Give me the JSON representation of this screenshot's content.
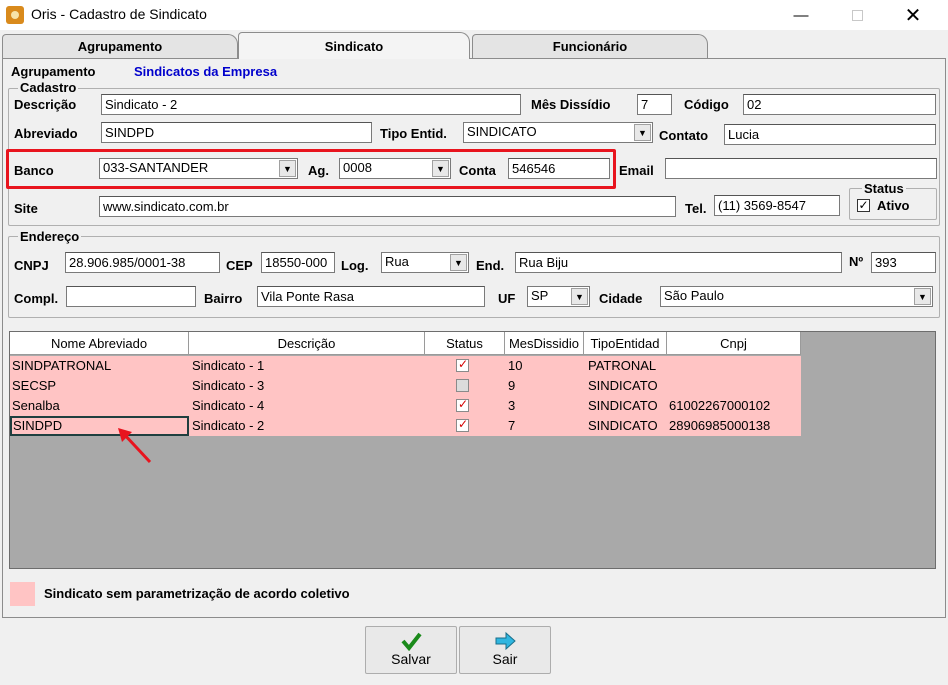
{
  "window": {
    "title": "Oris - Cadastro de Sindicato"
  },
  "tabs": [
    "Agrupamento",
    "Sindicato",
    "Funcionário"
  ],
  "agrupamento": {
    "label": "Agrupamento",
    "value": "Sindicatos da Empresa"
  },
  "cadastro": {
    "title": "Cadastro",
    "descricao_label": "Descrição",
    "descricao": "Sindicato - 2",
    "mes_dissidio_label": "Mês Dissídio",
    "mes_dissidio": "7",
    "codigo_label": "Código",
    "codigo": "02",
    "abreviado_label": "Abreviado",
    "abreviado": "SINDPD",
    "tipo_entid_label": "Tipo Entid.",
    "tipo_entid": "SINDICATO",
    "contato_label": "Contato",
    "contato": "Lucia",
    "banco_label": "Banco",
    "banco": "033-SANTANDER",
    "ag_label": "Ag.",
    "ag": "0008",
    "conta_label": "Conta",
    "conta": "546546",
    "email_label": "Email",
    "email": "",
    "site_label": "Site",
    "site": "www.sindicato.com.br",
    "tel_label": "Tel.",
    "tel": "(11) 3569-8547",
    "status_title": "Status",
    "ativo_label": "Ativo"
  },
  "endereco": {
    "title": "Endereço",
    "cnpj_label": "CNPJ",
    "cnpj": "28.906.985/0001-38",
    "cep_label": "CEP",
    "cep": "18550-000",
    "log_label": "Log.",
    "log": "Rua",
    "end_label": "End.",
    "end": "Rua Biju",
    "num_label": "Nº",
    "num": "393",
    "compl_label": "Compl.",
    "compl": "",
    "bairro_label": "Bairro",
    "bairro": "Vila Ponte Rasa",
    "uf_label": "UF",
    "uf": "SP",
    "cidade_label": "Cidade",
    "cidade": "São Paulo"
  },
  "grid": {
    "headers": [
      "Nome Abreviado",
      "Descrição",
      "Status",
      "MesDissidio",
      "TipoEntidad",
      "Cnpj"
    ],
    "rows": [
      {
        "nome": "SINDPATRONAL",
        "descricao": "Sindicato - 1",
        "status": true,
        "mes": "10",
        "tipo": "PATRONAL",
        "cnpj": ""
      },
      {
        "nome": "SECSP",
        "descricao": "Sindicato - 3",
        "status": false,
        "mes": "9",
        "tipo": "SINDICATO",
        "cnpj": ""
      },
      {
        "nome": "Senalba",
        "descricao": "Sindicato - 4",
        "status": true,
        "mes": "3",
        "tipo": "SINDICATO",
        "cnpj": "61002267000102"
      },
      {
        "nome": "SINDPD",
        "descricao": "Sindicato - 2",
        "status": true,
        "mes": "7",
        "tipo": "SINDICATO",
        "cnpj": "28906985000138"
      }
    ]
  },
  "legend": {
    "text": "Sindicato sem parametrização de acordo coletivo",
    "color": "#ffc4c4"
  },
  "buttons": {
    "salvar": "Salvar",
    "sair": "Sair"
  },
  "colors": {
    "highlight_box": "#e8141e",
    "arrow": "#e8141e",
    "link_text": "#0000cc"
  }
}
